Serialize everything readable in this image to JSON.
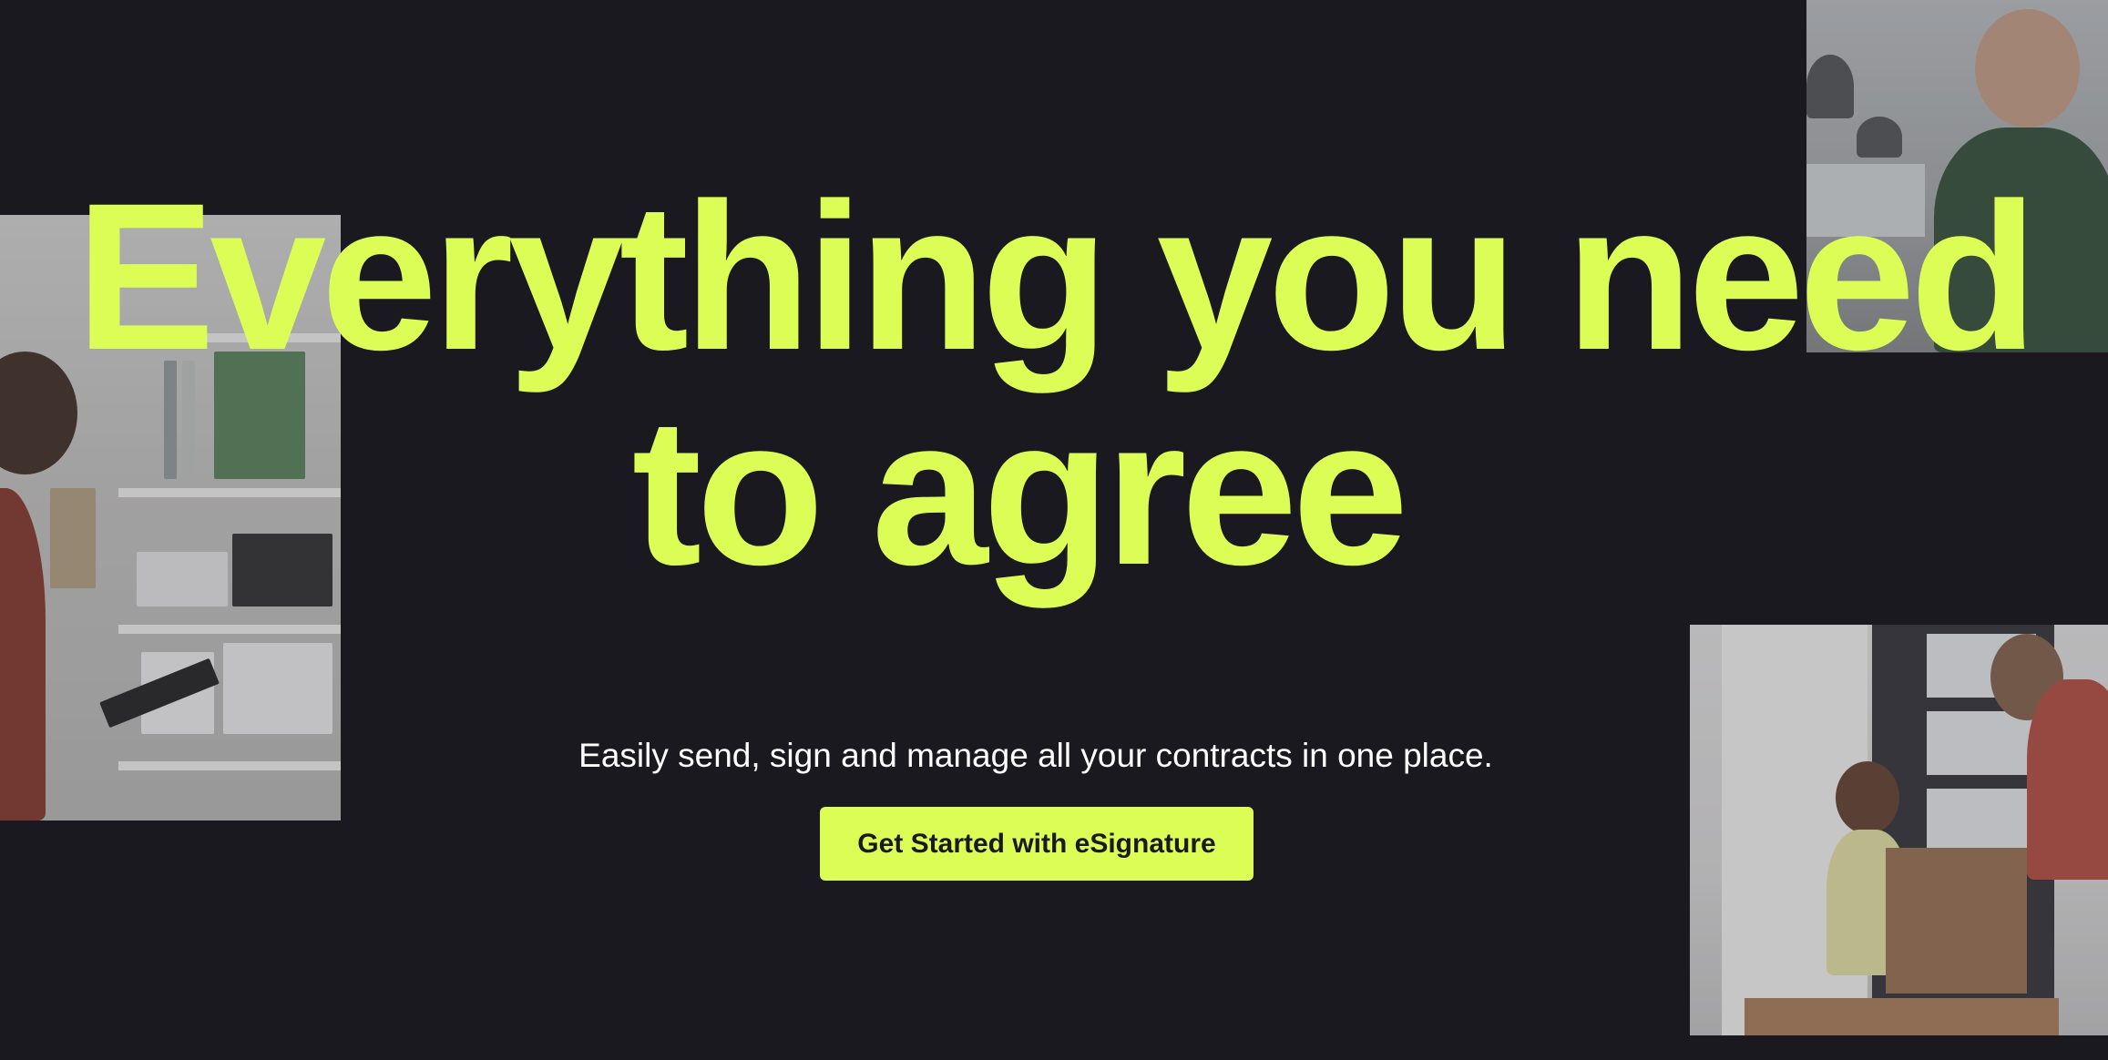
{
  "hero": {
    "headline_line_1": "Everything you need",
    "headline_line_2": "to agree",
    "subtitle": "Easily send, sign and manage all your contracts in one place.",
    "cta_label": "Get Started with eSignature"
  },
  "colors": {
    "background": "#1b1920",
    "accent": "#dcfd55",
    "text": "#ffffff"
  },
  "photos": [
    {
      "name": "photo-man-with-tablet-at-shelves"
    },
    {
      "name": "photo-woman-in-apron-smiling"
    },
    {
      "name": "photo-man-and-child-with-moving-box"
    }
  ]
}
